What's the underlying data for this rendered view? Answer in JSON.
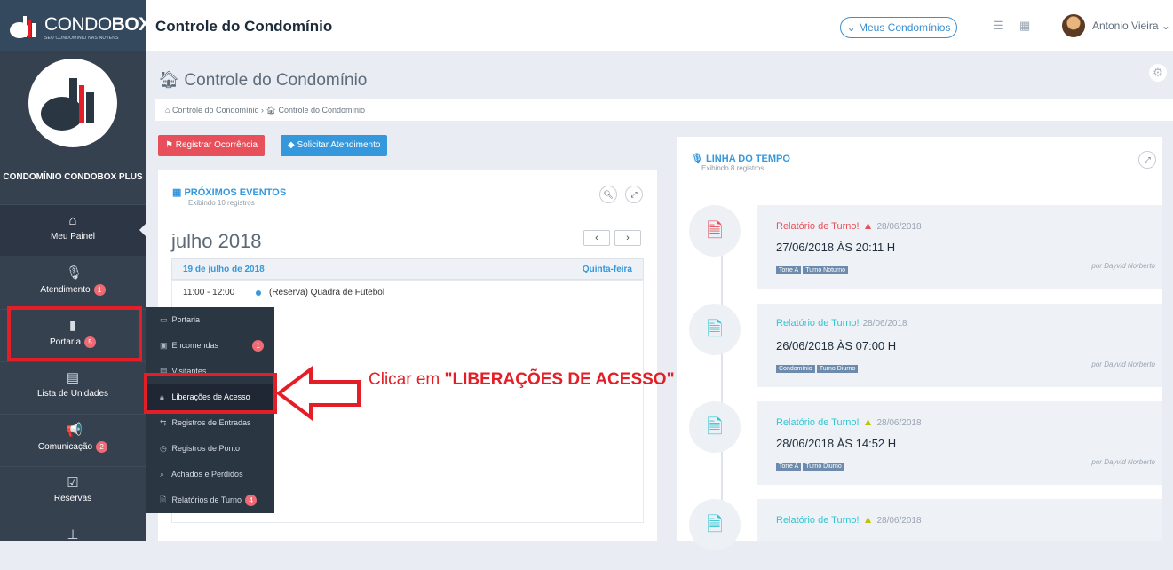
{
  "brand": {
    "name_light": "CONDO",
    "name_bold": "BOX",
    "tagline": "SEU CONDOMINIO NAS NUVENS"
  },
  "header": {
    "title": "Controle do Condomínio",
    "condo_button": "Meus Condomínios",
    "user_name": "Antonio Vieira",
    "icons": [
      "list-icon",
      "calendar-icon",
      "chevron-down-icon"
    ]
  },
  "sidebar": {
    "condo_name": "CONDOMÍNIO CONDOBOX PLUS",
    "items": [
      {
        "label": "Meu Painel",
        "icon": "home-icon",
        "badge": ""
      },
      {
        "label": "Atendimento",
        "icon": "microphone-icon",
        "badge": "1"
      },
      {
        "label": "Portaria",
        "icon": "building-icon",
        "badge": "5"
      },
      {
        "label": "Lista de Unidades",
        "icon": "building-list-icon",
        "badge": ""
      },
      {
        "label": "Comunicação",
        "icon": "megaphone-icon",
        "badge": "2"
      },
      {
        "label": "Reservas",
        "icon": "calendar-check-icon",
        "badge": ""
      },
      {
        "label": "",
        "icon": "pin-icon",
        "badge": ""
      }
    ]
  },
  "page": {
    "title": "Controle do Condomínio",
    "breadcrumb": [
      "Controle do Condomínio",
      "Controle do Condomínio"
    ],
    "buttons": {
      "register": "Registrar Ocorrência",
      "request": "Solicitar Atendimento"
    }
  },
  "events": {
    "title": "PRÓXIMOS EVENTOS",
    "subtitle": "Exibindo 10 registros",
    "month": "julho 2018",
    "date": "19 de julho de 2018",
    "weekday": "Quinta-feira",
    "items": [
      {
        "time": "11:00 - 12:00",
        "text": "(Reserva) Quadra de Futebol"
      }
    ]
  },
  "dropdown": {
    "items": [
      {
        "label": "Portaria",
        "icon": "monitor-icon",
        "badge": ""
      },
      {
        "label": "Encomendas",
        "icon": "box-icon",
        "badge": "1"
      },
      {
        "label": "Visitantes",
        "icon": "id-card-icon",
        "badge": ""
      },
      {
        "label": "Liberações de Acesso",
        "icon": "lock-icon",
        "badge": ""
      },
      {
        "label": "Registros de Entradas",
        "icon": "exchange-icon",
        "badge": ""
      },
      {
        "label": "Registros de Ponto",
        "icon": "clock-icon",
        "badge": ""
      },
      {
        "label": "Achados e Perdidos",
        "icon": "search-icon",
        "badge": ""
      },
      {
        "label": "Relatórios de Turno",
        "icon": "report-icon",
        "badge": "4"
      }
    ]
  },
  "annotation": {
    "prefix": "Clicar em ",
    "bold": "\"LIBERAÇÕES DE ACESSO\""
  },
  "timeline": {
    "title": "LINHA DO TEMPO",
    "subtitle": "Exibindo 8 registros",
    "entries": [
      {
        "title": "Relatório de Turno!",
        "warn": "red",
        "date": "28/06/2018",
        "heading": "27/06/2018 ÀS 20:11 H",
        "tags": [
          "Torre A",
          "Turno Noturno"
        ],
        "by": "por Dayvid Norberto",
        "icon_color": "#e7505a"
      },
      {
        "title": "Relatório de Turno!",
        "warn": "",
        "date": "28/06/2018",
        "heading": "26/06/2018 ÀS 07:00 H",
        "tags": [
          "Condomínio",
          "Turno Diurno"
        ],
        "by": "por Dayvid Norberto",
        "icon_color": "#32c5d2"
      },
      {
        "title": "Relatório de Turno!",
        "warn": "yellow",
        "date": "28/06/2018",
        "heading": "28/06/2018 ÀS 14:52 H",
        "tags": [
          "Torre A",
          "Turno Diurno"
        ],
        "by": "por Dayvid Norberto",
        "icon_color": "#32c5d2"
      },
      {
        "title": "Relatório de Turno!",
        "warn": "yellow",
        "date": "28/06/2018",
        "heading": "",
        "tags": [],
        "by": "",
        "icon_color": "#32c5d2"
      }
    ]
  },
  "colors": {
    "sidebar": "#364150",
    "accent": "#3598dc",
    "danger": "#e7505a",
    "success": "#32c5d2",
    "annotation": "#e41e26"
  }
}
